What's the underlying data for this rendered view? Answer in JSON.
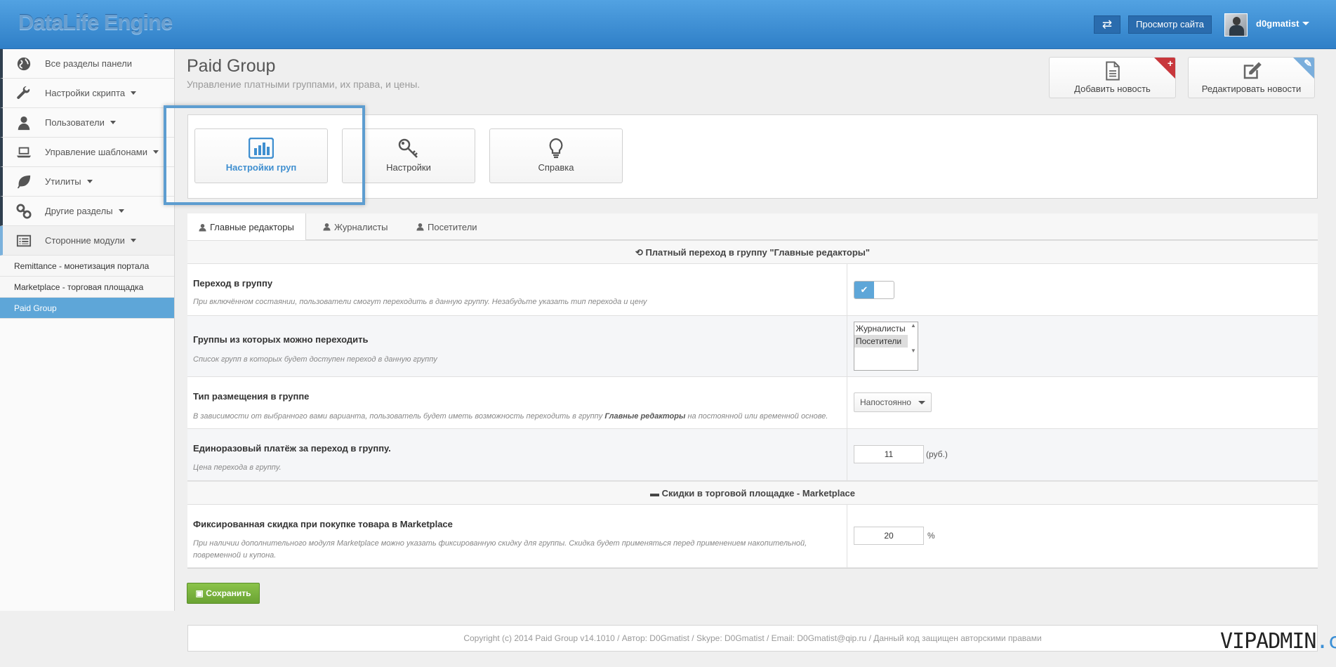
{
  "header": {
    "logo": "DataLife Engine",
    "swap_icon": "⇄",
    "view_site": "Просмотр сайта",
    "username": "d0gmatist"
  },
  "sidebar": {
    "items": [
      {
        "label": "Все разделы панели",
        "icon": "globe-icon",
        "dropdown": false
      },
      {
        "label": "Настройки скрипта",
        "icon": "wrench-icon",
        "dropdown": true
      },
      {
        "label": "Пользователи",
        "icon": "user-icon",
        "dropdown": true
      },
      {
        "label": "Управление шаблонами",
        "icon": "laptop-icon",
        "dropdown": true
      },
      {
        "label": "Утилиты",
        "icon": "leaf-icon",
        "dropdown": true
      },
      {
        "label": "Другие разделы",
        "icon": "link-icon",
        "dropdown": true
      },
      {
        "label": "Сторонние модули",
        "icon": "list-icon",
        "dropdown": true
      }
    ],
    "subitems": [
      {
        "label": "Remittance - монетизация портала"
      },
      {
        "label": "Marketplace - торговая площадка"
      },
      {
        "label": "Paid Group"
      }
    ]
  },
  "page": {
    "title": "Paid Group",
    "subtitle": "Управление платными группами, их права, и цены.",
    "add_news": "Добавить новость",
    "edit_news": "Редактировать новости"
  },
  "tiles": [
    {
      "label": "Настройки груп",
      "icon": "bar-chart-icon"
    },
    {
      "label": "Настройки",
      "icon": "key-icon"
    },
    {
      "label": "Справка",
      "icon": "lightbulb-icon"
    }
  ],
  "tabs": [
    "Главные редакторы",
    "Журналисты",
    "Посетители"
  ],
  "section1": "Платный переход в группу \"Главные редакторы\"",
  "rows": {
    "transition": {
      "title": "Переход в группу",
      "desc": "При включённом состаянии, пользователи смогут переходить в данную группу. Незабудьте указать тип перехода и цену",
      "toggle_on": "✔"
    },
    "groups": {
      "title": "Группы из которых можно переходить",
      "desc": "Список групп в которых будет доступен переход в данную группу",
      "options": [
        "Журналисты",
        "Посетители"
      ],
      "selected": "Посетители"
    },
    "placement": {
      "title": "Тип размещения в группе",
      "desc_prefix": "В зависимости от выбранного вами варианта, пользователь будет иметь возможность переходить в группу",
      "desc_bold": "Главные редакторы",
      "desc_suffix": "на постоянной или временной основе.",
      "value": "Напостоянно"
    },
    "payment": {
      "title": "Единоразовый платёж за переход в группу.",
      "desc": "Цена перехода в группу.",
      "value": "11",
      "unit": "(руб.)"
    }
  },
  "section2": "Скидки в торговой площадке - Marketplace",
  "discount": {
    "title": "Фиксированная скидка при покупке товара в Marketplace",
    "desc": "При наличии дополнительного модуля Marketplace можно указать фиксированную скидку для группы. Скидка будет применяться перед применением накопительной, повременной и купона.",
    "value": "20",
    "unit": "%"
  },
  "save_label": "Сохранить",
  "footer": "Copyright (c) 2014 Paid Group v14.1010 / Автор: D0Gmatist / Skype: D0Gmatist / Email: D0Gmatist@qip.ru / Данный код защищен авторскими правами",
  "watermark": {
    "main": "VIPADMIN",
    "suffix": ".club"
  },
  "colors": {
    "accent": "#5ea6d8",
    "header": "#3f8fd6",
    "save": "#6aa333",
    "corner_red": "#c8373c"
  }
}
